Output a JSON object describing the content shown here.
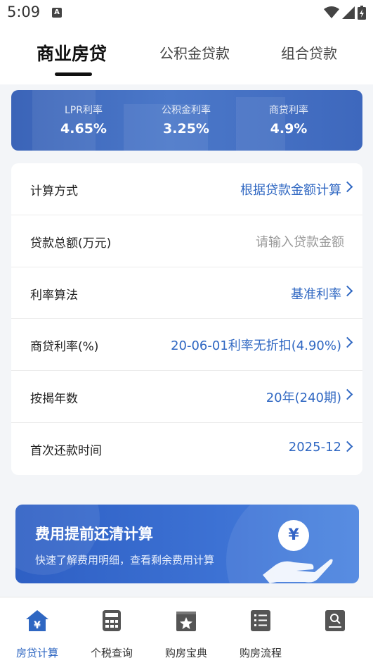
{
  "status": {
    "time": "5:09",
    "notif": "A"
  },
  "tabs": [
    {
      "label": "商业房贷",
      "active": true
    },
    {
      "label": "公积金贷款",
      "active": false
    },
    {
      "label": "组合贷款",
      "active": false
    }
  ],
  "rates": [
    {
      "label": "LPR利率",
      "value": "4.65%"
    },
    {
      "label": "公积金利率",
      "value": "3.25%"
    },
    {
      "label": "商贷利率",
      "value": "4.9%"
    }
  ],
  "form": {
    "calc_method": {
      "label": "计算方式",
      "value": "根据贷款金额计算"
    },
    "loan_amount": {
      "label": "贷款总额(万元)",
      "placeholder": "请输入贷款金额"
    },
    "rate_method": {
      "label": "利率算法",
      "value": "基准利率"
    },
    "commercial_rate": {
      "label": "商贷利率(%)",
      "value": "20-06-01利率无折扣(4.90%)"
    },
    "years": {
      "label": "按揭年数",
      "value": "20年(240期)"
    },
    "first_payment": {
      "label": "首次还款时间",
      "value": "2025-12"
    }
  },
  "promo": {
    "title": "费用提前还清计算",
    "subtitle": "快速了解费用明细，查看剩余费用计算",
    "coin_symbol": "¥"
  },
  "nav": [
    {
      "label": "房贷计算",
      "icon": "house-yen-icon",
      "active": true
    },
    {
      "label": "个税查询",
      "icon": "calculator-icon",
      "active": false
    },
    {
      "label": "购房宝典",
      "icon": "star-book-icon",
      "active": false
    },
    {
      "label": "购房流程",
      "icon": "checklist-icon",
      "active": false
    },
    {
      "label": "",
      "icon": "search-doc-icon",
      "active": false
    }
  ],
  "colors": {
    "accent": "#2f67c2",
    "banner": "#3b64b8"
  }
}
